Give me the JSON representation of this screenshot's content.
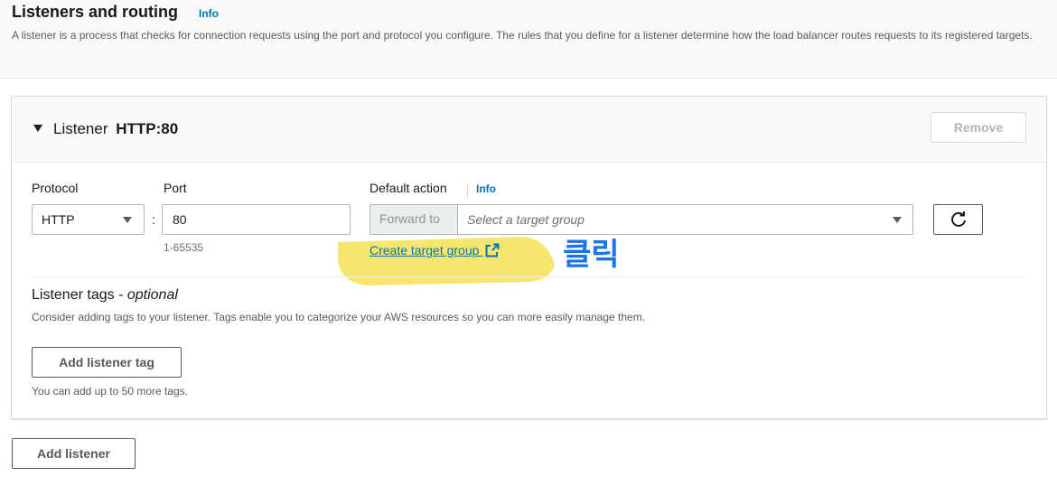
{
  "section": {
    "title": "Listeners and routing",
    "info": "Info",
    "description": "A listener is a process that checks for connection requests using the port and protocol you configure. The rules that you define for a listener determine how the load balancer routes requests to its registered targets."
  },
  "listener": {
    "prefix": "Listener",
    "name": "HTTP:80",
    "remove_label": "Remove",
    "protocol": {
      "label": "Protocol",
      "value": "HTTP",
      "separator": ":"
    },
    "port": {
      "label": "Port",
      "value": "80",
      "hint": "1-65535"
    },
    "default_action": {
      "label": "Default action",
      "info": "Info",
      "addon": "Forward to",
      "placeholder": "Select a target group",
      "create_link": "Create target group"
    },
    "tags": {
      "title": "Listener tags",
      "optional": "optional",
      "description": "Consider adding tags to your listener. Tags enable you to categorize your AWS resources so you can more easily manage them.",
      "add_label": "Add listener tag",
      "hint": "You can add up to 50 more tags."
    }
  },
  "add_listener_label": "Add listener",
  "annotation": {
    "text": "클릭",
    "highlight_color": "#f5e04a",
    "text_color": "#1a73e8"
  },
  "colors": {
    "link": "#0073bb",
    "text": "#16191f",
    "muted": "#687078",
    "border": "#aab7b8"
  }
}
